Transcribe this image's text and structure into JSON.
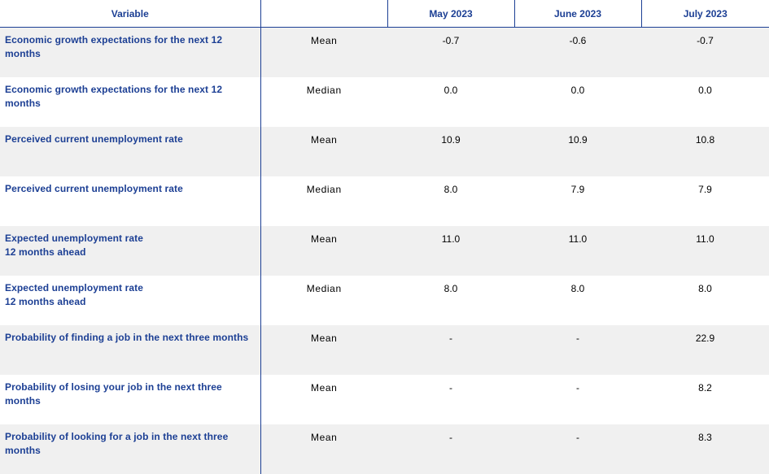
{
  "header": {
    "variable": "Variable",
    "statistic": "",
    "months": [
      "May 2023",
      "June 2023",
      "July 2023"
    ]
  },
  "rows": [
    {
      "variable": "Economic growth expectations for the next 12\nmonths",
      "stat": "Mean",
      "values": [
        "-0.7",
        "-0.6",
        "-0.7"
      ]
    },
    {
      "variable": "Economic growth expectations for the next 12\nmonths",
      "stat": "Median",
      "values": [
        "0.0",
        "0.0",
        "0.0"
      ]
    },
    {
      "variable": "Perceived current unemployment rate",
      "stat": "Mean",
      "values": [
        "10.9",
        "10.9",
        "10.8"
      ]
    },
    {
      "variable": "Perceived current unemployment rate",
      "stat": "Median",
      "values": [
        "8.0",
        "7.9",
        "7.9"
      ]
    },
    {
      "variable": "Expected unemployment rate\n12 months ahead",
      "stat": "Mean",
      "values": [
        "11.0",
        "11.0",
        "11.0"
      ]
    },
    {
      "variable": "Expected unemployment rate\n12 months ahead",
      "stat": "Median",
      "values": [
        "8.0",
        "8.0",
        "8.0"
      ]
    },
    {
      "variable": "Probability of finding a job in the next three months",
      "stat": "Mean",
      "values": [
        "-",
        "-",
        "22.9"
      ]
    },
    {
      "variable": "Probability of losing your job in the next three\nmonths",
      "stat": "Mean",
      "values": [
        "-",
        "-",
        "8.2"
      ]
    },
    {
      "variable": "Probability of looking for a job in the next three\nmonths",
      "stat": "Mean",
      "values": [
        "-",
        "-",
        "8.3"
      ]
    }
  ],
  "colors": {
    "accent": "#1c3f94",
    "row_shade": "#f0f0f0"
  }
}
